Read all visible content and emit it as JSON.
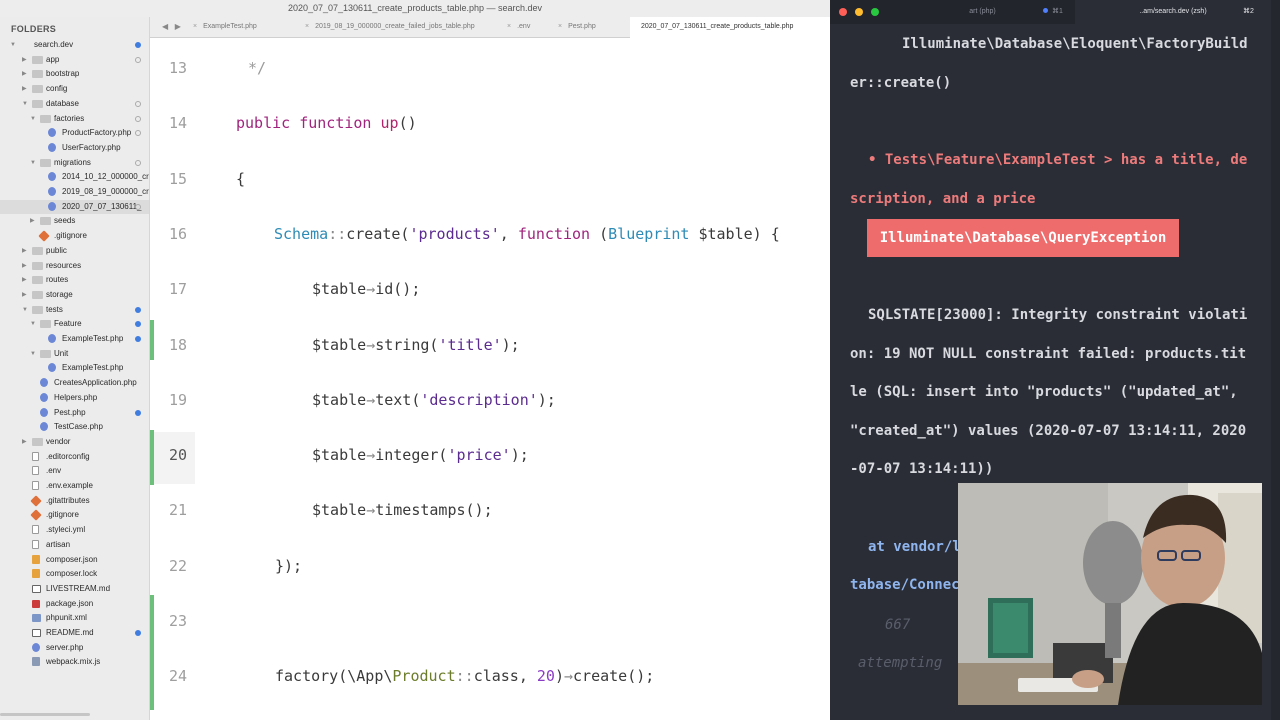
{
  "editor": {
    "title": "2020_07_07_130611_create_products_table.php — search.dev",
    "tab_nav": "◀ ▶",
    "tabs": [
      {
        "label": "ExampleTest.php"
      },
      {
        "label": "2019_08_19_000000_create_failed_jobs_table.php"
      },
      {
        "label": ".env"
      },
      {
        "label": "Pest.php"
      },
      {
        "label": "2020_07_07_130611_create_products_table.php",
        "active": true
      }
    ],
    "active_line": "20"
  },
  "sidebar": {
    "heading": "FOLDERS",
    "items": [
      {
        "label": "search.dev",
        "icon": "chevron-down-icon",
        "dot": "blue"
      },
      {
        "label": "app",
        "icon": "folder-icon",
        "dot": "ring"
      },
      {
        "label": "bootstrap",
        "icon": "folder-icon"
      },
      {
        "label": "config",
        "icon": "folder-icon"
      },
      {
        "label": "database",
        "icon": "folder-icon",
        "dot": "ring"
      },
      {
        "label": "factories",
        "icon": "folder-icon",
        "dot": "ring"
      },
      {
        "label": "ProductFactory.php",
        "icon": "php-file-icon",
        "dot": "ring"
      },
      {
        "label": "UserFactory.php",
        "icon": "php-file-icon"
      },
      {
        "label": "migrations",
        "icon": "folder-icon",
        "dot": "ring"
      },
      {
        "label": "2014_10_12_000000_crea",
        "icon": "php-file-icon"
      },
      {
        "label": "2019_08_19_000000_crea",
        "icon": "php-file-icon"
      },
      {
        "label": "2020_07_07_130611_",
        "icon": "php-file-icon",
        "dot": "ring",
        "selected": true
      },
      {
        "label": "seeds",
        "icon": "folder-icon"
      },
      {
        "label": ".gitignore",
        "icon": "git-icon"
      },
      {
        "label": "public",
        "icon": "folder-icon"
      },
      {
        "label": "resources",
        "icon": "folder-icon"
      },
      {
        "label": "routes",
        "icon": "folder-icon"
      },
      {
        "label": "storage",
        "icon": "folder-icon"
      },
      {
        "label": "tests",
        "icon": "folder-icon",
        "dot": "blue"
      },
      {
        "label": "Feature",
        "icon": "folder-icon",
        "dot": "blue"
      },
      {
        "label": "ExampleTest.php",
        "icon": "php-file-icon",
        "dot": "blue"
      },
      {
        "label": "Unit",
        "icon": "folder-icon"
      },
      {
        "label": "ExampleTest.php",
        "icon": "php-file-icon"
      },
      {
        "label": "CreatesApplication.php",
        "icon": "php-file-icon"
      },
      {
        "label": "Helpers.php",
        "icon": "php-file-icon"
      },
      {
        "label": "Pest.php",
        "icon": "php-file-icon",
        "dot": "blue"
      },
      {
        "label": "TestCase.php",
        "icon": "php-file-icon"
      },
      {
        "label": "vendor",
        "icon": "folder-icon"
      },
      {
        "label": ".editorconfig",
        "icon": "file-icon"
      },
      {
        "label": ".env",
        "icon": "file-icon"
      },
      {
        "label": ".env.example",
        "icon": "file-icon"
      },
      {
        "label": ".gitattributes",
        "icon": "git-icon"
      },
      {
        "label": ".gitignore",
        "icon": "git-icon"
      },
      {
        "label": ".styleci.yml",
        "icon": "file-icon"
      },
      {
        "label": "artisan",
        "icon": "file-icon"
      },
      {
        "label": "composer.json",
        "icon": "json-icon"
      },
      {
        "label": "composer.lock",
        "icon": "json-icon"
      },
      {
        "label": "LIVESTREAM.md",
        "icon": "markdown-icon"
      },
      {
        "label": "package.json",
        "icon": "npm-icon"
      },
      {
        "label": "phpunit.xml",
        "icon": "xml-icon"
      },
      {
        "label": "README.md",
        "icon": "markdown-icon",
        "dot": "blue"
      },
      {
        "label": "server.php",
        "icon": "php-file-icon"
      },
      {
        "label": "webpack.mix.js",
        "icon": "js-file-icon"
      }
    ]
  },
  "code": {
    "lines": [
      {
        "n": "13",
        "html": "<span class='cmt'>*/</span>"
      },
      {
        "n": "14",
        "html": "<span class='kw'>public</span> <span class='kw'>function</span> <span class='fn'>up</span>()"
      },
      {
        "n": "15",
        "html": "{"
      },
      {
        "n": "16",
        "html": "<span class='cls'>Schema</span><span class='op'>::</span>create(<span class='str'>'products'</span>, <span class='kw'>function</span> (<span class='cls'>Blueprint</span> $table) {"
      },
      {
        "n": "17",
        "html": "$table<span class='op'>→</span>id();"
      },
      {
        "n": "18",
        "html": "$table<span class='op'>→</span>string(<span class='str'>'title'</span>);"
      },
      {
        "n": "19",
        "html": "$table<span class='op'>→</span>text(<span class='str'>'description'</span>);"
      },
      {
        "n": "20",
        "html": "$table<span class='op'>→</span>integer(<span class='str'>'price'</span>);"
      },
      {
        "n": "21",
        "html": "$table<span class='op'>→</span>timestamps();"
      },
      {
        "n": "22",
        "html": "});"
      },
      {
        "n": "23",
        "html": ""
      },
      {
        "n": "24",
        "html": "factory(\\App\\<span class='class-lit'>Product</span><span class='op'>::</span>class, <span class='num'>20</span>)<span class='op'>→</span>create();"
      }
    ]
  },
  "terminal": {
    "tabs": [
      {
        "label": "art (php)",
        "shortcut": "⌘1"
      },
      {
        "label": "..am/search.dev (zsh)",
        "shortcut": "⌘2",
        "active": true
      }
    ],
    "lines": [
      {
        "text": "Illuminate\\Database\\Eloquent\\FactoryBuild",
        "cls": ""
      },
      {
        "text": "er::create()",
        "cls": ""
      },
      {
        "text": "• Tests\\Feature\\ExampleTest > has a title, de",
        "cls": "red"
      },
      {
        "text": "scription, and a price",
        "cls": "red"
      },
      {
        "text": "SQLSTATE[23000]: Integrity constraint violati",
        "cls": ""
      },
      {
        "text": "on: 19 NOT NULL constraint failed: products.tit",
        "cls": ""
      },
      {
        "text": "le (SQL: insert into \"products\" (\"updated_at\",",
        "cls": ""
      },
      {
        "text": "\"created_at\") values (2020-07-07 13:14:11, 2020",
        "cls": ""
      },
      {
        "text": "-07-07 13:14:11))",
        "cls": ""
      },
      {
        "text": "at vendor/l",
        "cls": "blue"
      },
      {
        "text": "tabase/Connec",
        "cls": "blue"
      },
      {
        "text": "667",
        "cls": "dim"
      },
      {
        "text": "attempting",
        "cls": "dim"
      }
    ],
    "exception": "Illuminate\\Database\\QueryException"
  }
}
